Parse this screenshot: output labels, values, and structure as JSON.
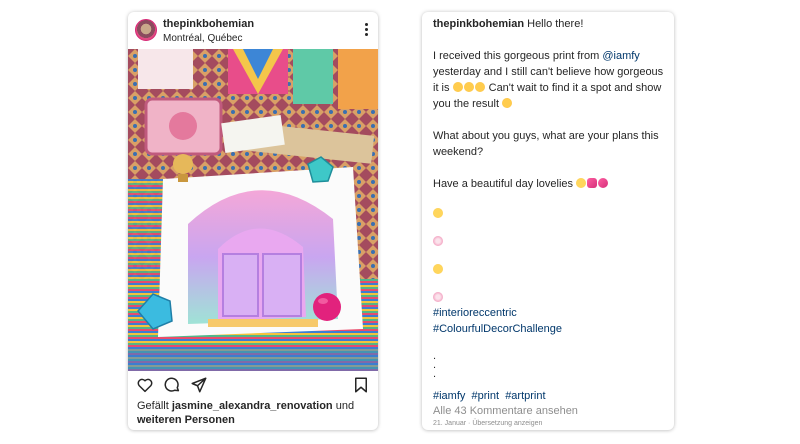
{
  "post": {
    "username": "thepinkbohemian",
    "location": "Montréal, Québec",
    "likes_prefix": "Gefällt ",
    "likes_user": "jasmine_alexandra_renovation",
    "likes_suffix": " und",
    "likes_more": "weiteren Personen",
    "icons": [
      "heart-icon",
      "comment-icon",
      "share-icon",
      "bookmark-icon",
      "more-options-icon"
    ]
  },
  "caption": {
    "username": "thepinkbohemian",
    "greeting": "Hello there!",
    "p1_a": "I received this gorgeous print from ",
    "p1_mention": "@iamfy",
    "p1_b": " yesterday and I still can't believe how gorgeous it is ",
    "p1_c": " Can't wait to find it a spot and show you the result ",
    "p2": "What about you guys, what are your plans this weekend?",
    "p3": "Have a beautiful day lovelies ",
    "hashtags_1": [
      "#interioreccentric",
      "#ColourfulDecorChallenge"
    ],
    "dots": [
      ".",
      ".",
      "."
    ],
    "hashtags_2": [
      "#iamfy",
      "#print",
      "#artprint"
    ],
    "comments_link": "Alle 43 Kommentare ansehen",
    "date": "21. Januar",
    "separator": " · ",
    "translate": "Übersetzung anzeigen"
  },
  "colors": {
    "text": "#262626",
    "link": "#00376b",
    "muted": "#8e8e8e"
  }
}
